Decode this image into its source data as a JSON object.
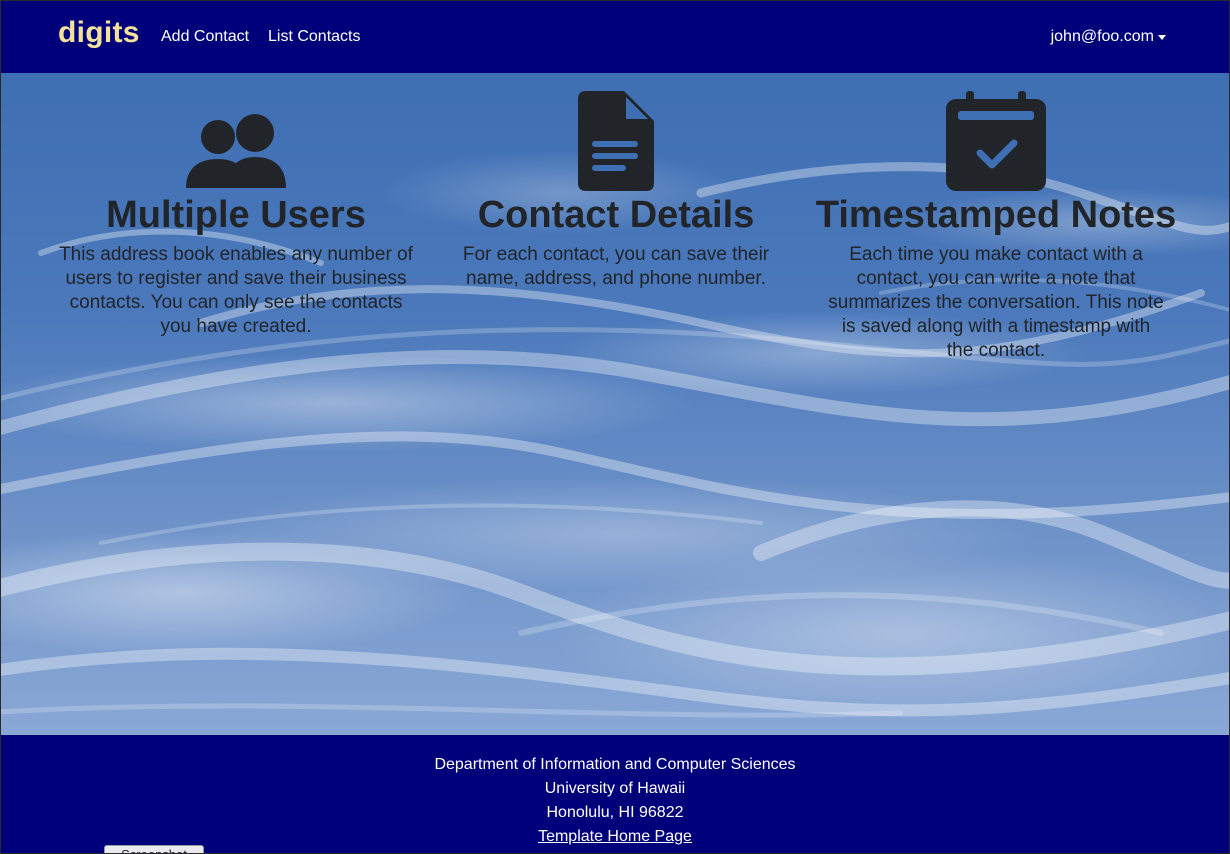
{
  "navbar": {
    "brand": "digits",
    "links": [
      "Add Contact",
      "List Contacts"
    ],
    "user": "john@foo.com"
  },
  "features": [
    {
      "icon": "users-icon",
      "title": "Multiple Users",
      "text": "This address book enables any number of users to register and save their business contacts. You can only see the contacts you have created."
    },
    {
      "icon": "file-icon",
      "title": "Contact Details",
      "text": "For each contact, you can save their name, address, and phone number."
    },
    {
      "icon": "calendar-check-icon",
      "title": "Timestamped Notes",
      "text": "Each time you make contact with a contact, you can write a note that summarizes the conversation. This note is saved along with a timestamp with the contact."
    }
  ],
  "footer": {
    "lines": [
      "Department of Information and Computer Sciences",
      "University of Hawaii",
      "Honolulu, HI 96822"
    ],
    "link": "Template Home Page"
  },
  "screenshot_button": "Screenshot",
  "colors": {
    "navbar_bg": "#00007a",
    "brand": "#f3e39a",
    "sky": "#4a78bb",
    "text_dark": "#212529"
  }
}
